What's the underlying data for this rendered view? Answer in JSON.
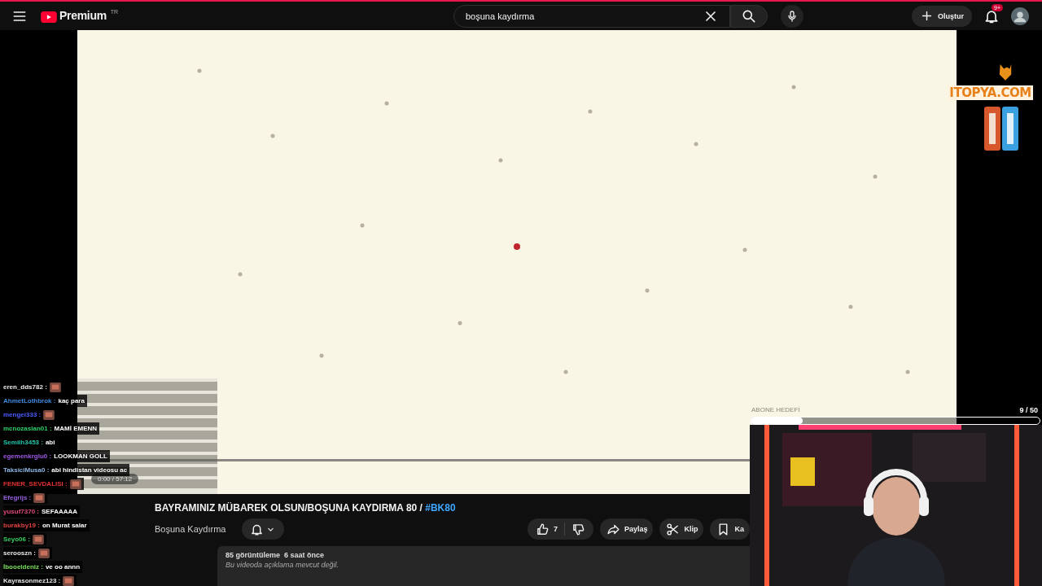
{
  "topbar": {
    "logo": {
      "text": "Premium",
      "country": "TR"
    },
    "search": {
      "value": "boşuna kaydırma"
    },
    "create_button": "Oluştur",
    "notifications_badge": "9+"
  },
  "player": {
    "time": "0:00 / 57:12",
    "progress": {
      "level": 0
    }
  },
  "sponsor": {
    "text": "ITOPYA.COM"
  },
  "goal": {
    "label": "ABONE HEDEFİ",
    "count": "9  / 50",
    "level": 0.18
  },
  "chat": [
    {
      "user": "eren_dds782 :",
      "color": "#e8e8e8",
      "emote": true
    },
    {
      "user": "AhmetLothbrok :",
      "color": "#3d8be0",
      "text": "kaç para"
    },
    {
      "user": "mengei333 :",
      "color": "#4a5cff",
      "emote": true
    },
    {
      "user": "mcnozaslan01 :",
      "color": "#2fd06a",
      "text": "MAMİ EMENN"
    },
    {
      "user": "Semiih3453 :",
      "color": "#22c7a8",
      "text": "abi"
    },
    {
      "user": "egemenkrglu0 :",
      "color": "#a05ae8",
      "text": "LOOKMAN GOLL"
    },
    {
      "user": "TaksiciMusa0 :",
      "color": "#8fb8e8",
      "text": "abi hindistan videosu ac"
    },
    {
      "user": "FENER_SEVDALISI :",
      "color": "#e03030",
      "emote": true
    },
    {
      "user": "Efegrijs :",
      "color": "#9a62e8",
      "emote": true
    },
    {
      "user": "yusuf7370 :",
      "color": "#e04a7a",
      "text": "SEFAAAAA"
    },
    {
      "user": "burakby19 :",
      "color": "#e04444",
      "text": "on Murat salar"
    },
    {
      "user": "Seyo06 :",
      "color": "#3ad060",
      "emote": true
    },
    {
      "user": "serooszn :",
      "color": "#e8e8e8",
      "emote": true
    },
    {
      "user": "İbooeldeniz :",
      "color": "#7ae05a",
      "text": "ve oo annn"
    },
    {
      "user": "Kayrasonmez123 :",
      "color": "#e8e8e8",
      "emote": true
    }
  ],
  "video": {
    "title": "BAYRAMINIZ MÜBAREK OLSUN/BOŞUNA KAYDIRMA 80 / ",
    "hashtag": "#BK80",
    "channel": "Boşuna Kaydırma",
    "likes": "7",
    "actions": [
      "Paylaş",
      "Klip",
      "Ka"
    ],
    "views": "85 görüntüleme  6 saat önce",
    "description": "Bu videoda açıklama mevcut değil."
  }
}
